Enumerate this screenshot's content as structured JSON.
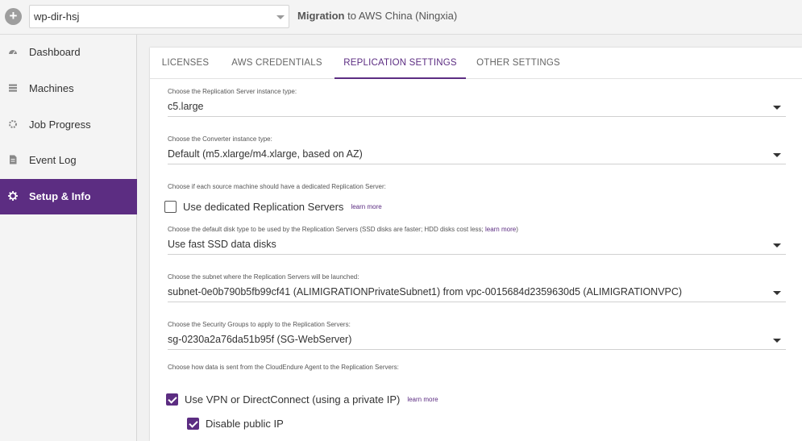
{
  "header": {
    "add_icon": "+",
    "project": "wp-dir-hsj",
    "migration_bold": "Migration",
    "migration_rest": " to AWS China (Ningxia)"
  },
  "sidebar": {
    "items": [
      {
        "label": "Dashboard",
        "icon": "dashboard-icon"
      },
      {
        "label": "Machines",
        "icon": "machines-icon"
      },
      {
        "label": "Job Progress",
        "icon": "job-progress-icon"
      },
      {
        "label": "Event Log",
        "icon": "event-log-icon"
      },
      {
        "label": "Setup & Info",
        "icon": "gear-icon",
        "active": true
      }
    ]
  },
  "tabs": [
    {
      "label": "LICENSES"
    },
    {
      "label": "AWS CREDENTIALS"
    },
    {
      "label": "REPLICATION SETTINGS",
      "active": true
    },
    {
      "label": "OTHER SETTINGS"
    }
  ],
  "settings": {
    "replication_instance": {
      "label": "Choose the Replication Server instance type:",
      "value": "c5.large"
    },
    "converter_instance": {
      "label": "Choose the Converter instance type:",
      "value": "Default (m5.xlarge/m4.xlarge, based on AZ)"
    },
    "dedicated": {
      "label": "Choose if each source machine should have a dedicated Replication Server:",
      "checkbox_label": "Use dedicated Replication Servers",
      "checked": false,
      "learn_more": "learn more"
    },
    "disk_type": {
      "label": "Choose the default disk type to be used by the Replication Servers (SSD disks are faster; HDD disks cost less; ",
      "link": "learn more",
      "label_end": ")",
      "value": "Use fast SSD data disks"
    },
    "subnet": {
      "label": "Choose the subnet where the Replication Servers will be launched:",
      "value": "subnet-0e0b790b5fb99cf41 (ALIMIGRATIONPrivateSubnet1) from vpc-0015684d2359630d5 (ALIMIGRATIONVPC)"
    },
    "security_groups": {
      "label": "Choose the Security Groups to apply to the Replication Servers:",
      "value": "sg-0230a2a76da51b95f (SG-WebServer)"
    },
    "data_route": {
      "label": "Choose how data is sent from the CloudEndure Agent to the Replication Servers:",
      "vpn_label": "Use VPN or DirectConnect (using a private IP)",
      "vpn_checked": true,
      "learn_more": "learn more",
      "disable_public_ip_label": "Disable public IP",
      "disable_public_ip_checked": true
    }
  },
  "colors": {
    "accent": "#5c2d82"
  }
}
